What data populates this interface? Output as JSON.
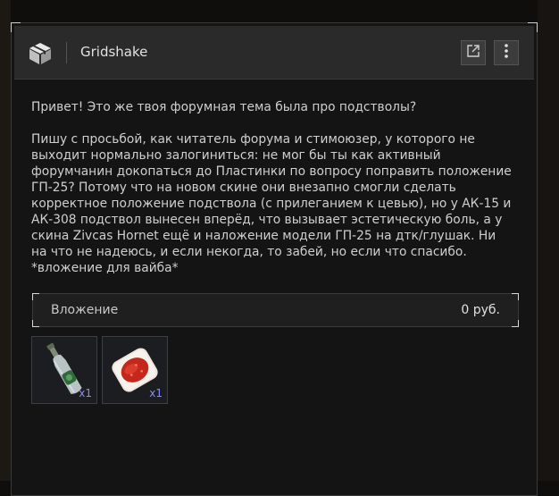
{
  "window": {
    "title": "Gridshake"
  },
  "icons": {
    "logo": "package-box-icon",
    "open": "external-link-icon",
    "menu": "more-vertical-icon"
  },
  "message": {
    "text": "Привет! Это же твоя форумная тема была про подстволы?\n\nПишу с просьбой, как читатель форума и стимоюзер, у которого не\nвыходит нормально залогиниться: не мог бы ты как активный\nфорумчанин докопаться до Пластинки по вопросу поправить положение\nГП-25? Потому что на новом скине они внезапно смогли сделать\nкорректное положение подствола (с прилеганием к цевью), но у АК-15 и\nАК-308 подствол вынесен вперёд, что вызывает эстетическую боль, а у\nскина Zivcas Hornet ещё и наложение модели ГП-25 на дтк/глушак. Ни\nна что не надеюсь, и если некогда, то забей, но если что спасибо.\n*вложение для вайба*"
  },
  "attachment": {
    "label": "Вложение",
    "value": "0  руб."
  },
  "items": [
    {
      "icon": "vodka-bottle-icon",
      "qty": "x1"
    },
    {
      "icon": "caviar-sandwich-icon",
      "qty": "x1"
    }
  ],
  "colors": {
    "background": "#141414",
    "header": "#2a2a2a",
    "accent_qty": "#8a8cff"
  }
}
